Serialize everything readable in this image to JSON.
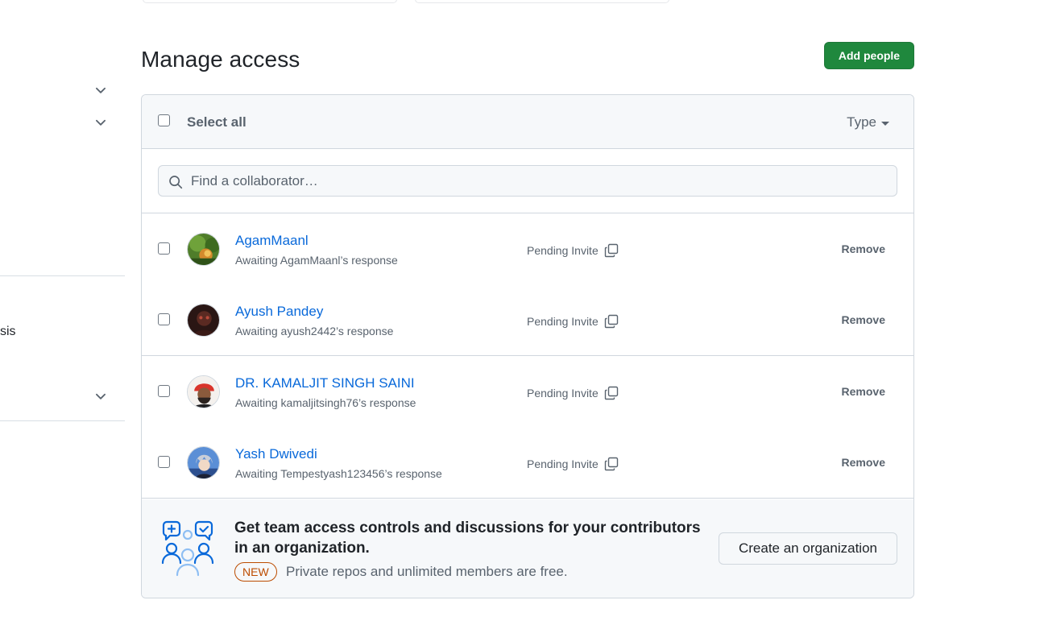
{
  "page": {
    "title": "Manage access",
    "add_people_label": "Add people"
  },
  "sidebar": {
    "partial_text": "sis"
  },
  "list_header": {
    "select_all_label": "Select all",
    "type_filter_label": "Type"
  },
  "search": {
    "placeholder": "Find a collaborator…",
    "value": ""
  },
  "collaborators": [
    {
      "name": "AgamMaanl",
      "status_line": "Awaiting AgamMaanl’s response",
      "invite_status": "Pending Invite",
      "remove_label": "Remove"
    },
    {
      "name": "Ayush Pandey",
      "status_line": "Awaiting ayush2442’s response",
      "invite_status": "Pending Invite",
      "remove_label": "Remove"
    },
    {
      "name": "DR. KAMALJIT SINGH SAINI",
      "status_line": "Awaiting kamaljitsingh76’s response",
      "invite_status": "Pending Invite",
      "remove_label": "Remove"
    },
    {
      "name": "Yash Dwivedi",
      "status_line": "Awaiting Tempestyash123456’s response",
      "invite_status": "Pending Invite",
      "remove_label": "Remove"
    }
  ],
  "promo": {
    "title": "Get team access controls and discussions for your contributors in an organization.",
    "badge": "NEW",
    "description": "Private repos and unlimited members are free.",
    "button_label": "Create an organization"
  },
  "colors": {
    "primary_button": "#1f883d",
    "link": "#0969da",
    "new_badge": "#bc4c00",
    "muted_text": "#59636e",
    "border": "#d0d7de"
  },
  "icons": {
    "sidebar_toggle": "chevron-down-icon",
    "search": "search-icon",
    "copy": "copy-icon",
    "promo": "people-discussion-icon"
  }
}
